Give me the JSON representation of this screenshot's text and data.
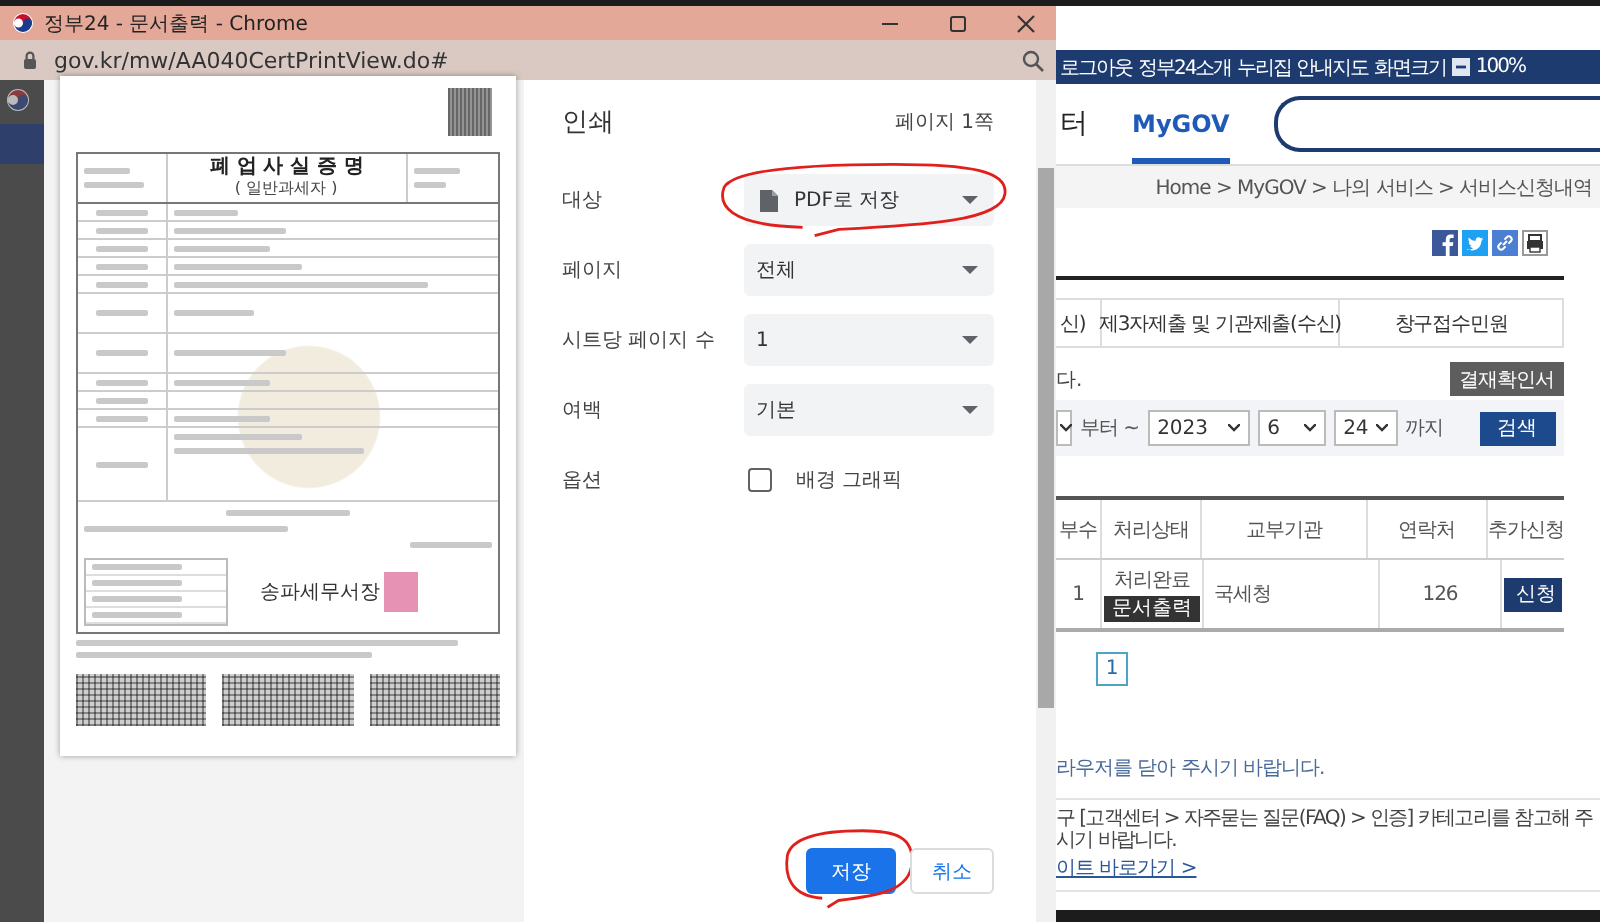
{
  "window": {
    "title": "정부24 - 문서출력 - Chrome",
    "url": "gov.kr/mw/AA040CertPrintView.do#"
  },
  "preview": {
    "document": {
      "title": "폐 업 사 실 증 명",
      "subtitle": "( 일반과세자 )",
      "issuer": "송파세무서장"
    }
  },
  "print": {
    "title": "인쇄",
    "page_count": "페이지 1쪽",
    "settings": [
      {
        "kind": "destination",
        "label": "대상",
        "value": "PDF로 저장",
        "circled": true
      },
      {
        "kind": "select",
        "label": "페이지",
        "value": "전체",
        "circled": false
      },
      {
        "kind": "select",
        "label": "시트당 페이지 수",
        "value": "1",
        "circled": false
      },
      {
        "kind": "select",
        "label": "여백",
        "value": "기본",
        "circled": false
      },
      {
        "kind": "checkbox",
        "label": "옵션",
        "value": "배경 그래픽",
        "checked": false,
        "circled": false
      }
    ],
    "buttons": [
      {
        "label": "저장",
        "primary": true,
        "circled": true
      },
      {
        "label": "취소",
        "primary": false,
        "circled": false
      }
    ]
  },
  "site": {
    "top_links": [
      "로그아웃",
      "정부24소개",
      "누리집 안내지도",
      "화면크기"
    ],
    "zoom_value": "100%",
    "nav": [
      {
        "label": "터",
        "selected": false
      },
      {
        "label": "MyGOV",
        "selected": true
      }
    ],
    "breadcrumb": "Home > MyGOV > 나의 서비스 > 서비스신청내역",
    "tabs": [
      {
        "label": "신)",
        "selected": false
      },
      {
        "label": "제3자제출 및 기관제출(수신)",
        "selected": false
      },
      {
        "label": "창구접수민원",
        "selected": false
      }
    ],
    "notice": "다.",
    "confirm_button": "결재확인서",
    "filter": {
      "from_label": "부터 ~",
      "year": "2023",
      "month": "6",
      "day": "24",
      "to_label": "까지",
      "search_button": "검색"
    },
    "table": {
      "columns": [
        "부수",
        "처리상태",
        "교부기관",
        "연락처",
        "추가신청"
      ],
      "rows": [
        {
          "copies": "1",
          "status": "처리완료",
          "print_button": "문서출력",
          "agency": "국세청",
          "phone": "126",
          "apply_button": "신청"
        }
      ]
    },
    "pagination": [
      {
        "label": "1",
        "selected": true
      }
    ],
    "footer_note": "라우저를 닫아 주시기 바랍니다.",
    "help": {
      "text": "구 [고객센터 > 자주묻는 질문(FAQ) > 인증] 카테고리를 참고해 주시기 바랍니다.",
      "link": "이트 바로가기 >"
    }
  }
}
